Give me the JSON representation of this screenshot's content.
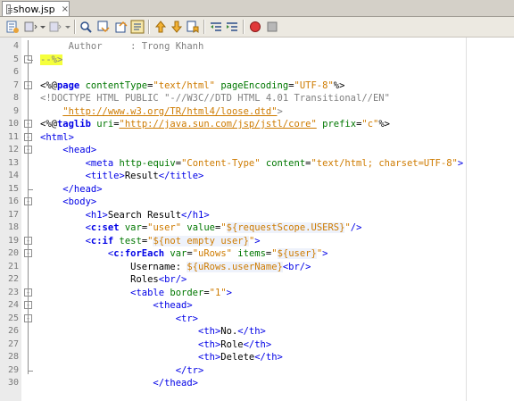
{
  "tab": {
    "title": "show.jsp",
    "close": "×"
  },
  "toolbar": {
    "buttons": [
      "go-to-source-icon",
      "back-icon",
      "forward-icon",
      "find-icon",
      "find-previous-icon",
      "find-next-icon",
      "toggle-highlight-icon",
      "previous-bookmark-icon",
      "next-bookmark-icon",
      "toggle-bookmark-icon",
      "shift-left-icon",
      "shift-right-icon",
      "start-macro-icon",
      "stop-macro-icon"
    ]
  },
  "editor": {
    "lines": [
      {
        "n": "4",
        "segs": [
          [
            "com",
            "     Author     : Trong Khanh"
          ]
        ]
      },
      {
        "n": "5",
        "segs": [
          [
            "yl",
            "--%>"
          ]
        ]
      },
      {
        "n": "6",
        "segs": []
      },
      {
        "n": "7",
        "segs": [
          [
            "dir",
            "<%@"
          ],
          [
            "kw",
            "page"
          ],
          [
            "attr",
            " contentType"
          ],
          [
            "dir",
            "="
          ],
          [
            "val",
            "\"text/html\""
          ],
          [
            "attr",
            " pageEncoding"
          ],
          [
            "dir",
            "="
          ],
          [
            "val",
            "\"UTF-8\""
          ],
          [
            "dir",
            "%>"
          ]
        ]
      },
      {
        "n": "8",
        "segs": [
          [
            "com",
            "<!DOCTYPE HTML PUBLIC \"-//W3C//DTD HTML 4.01 Transitional//EN\""
          ]
        ]
      },
      {
        "n": "9",
        "segs": [
          [
            "com",
            "    "
          ],
          [
            "url",
            "\"http://www.w3.org/TR/html4/loose.dtd\""
          ],
          [
            "com",
            ">"
          ]
        ]
      },
      {
        "n": "10",
        "segs": [
          [
            "dir",
            "<%@"
          ],
          [
            "kw",
            "taglib"
          ],
          [
            "attr",
            " uri"
          ],
          [
            "dir",
            "="
          ],
          [
            "url",
            "\"http://java.sun.com/jsp/jstl/core\""
          ],
          [
            "attr",
            " prefix"
          ],
          [
            "dir",
            "="
          ],
          [
            "val",
            "\"c\""
          ],
          [
            "dir",
            "%>"
          ]
        ]
      },
      {
        "n": "11",
        "segs": [
          [
            "tag",
            "<html>"
          ]
        ]
      },
      {
        "n": "12",
        "segs": [
          [
            "tag",
            "    <head>"
          ]
        ]
      },
      {
        "n": "13",
        "segs": [
          [
            "tag",
            "        <meta"
          ],
          [
            "attr",
            " http-equiv"
          ],
          [
            "dir",
            "="
          ],
          [
            "val",
            "\"Content-Type\""
          ],
          [
            "attr",
            " content"
          ],
          [
            "dir",
            "="
          ],
          [
            "val",
            "\"text/html; charset=UTF-8\""
          ],
          [
            "tag",
            ">"
          ]
        ]
      },
      {
        "n": "14",
        "segs": [
          [
            "tag",
            "        <title>"
          ],
          [
            "dir",
            "Result"
          ],
          [
            "tag",
            "</title>"
          ]
        ]
      },
      {
        "n": "15",
        "segs": [
          [
            "tag",
            "    </head>"
          ]
        ]
      },
      {
        "n": "16",
        "segs": [
          [
            "tag",
            "    <body>"
          ]
        ]
      },
      {
        "n": "17",
        "segs": [
          [
            "tag",
            "        <h1>"
          ],
          [
            "dir",
            "Search Result"
          ],
          [
            "tag",
            "</h1>"
          ]
        ]
      },
      {
        "n": "18",
        "segs": [
          [
            "tag",
            "        <"
          ],
          [
            "kw",
            "c:set"
          ],
          [
            "attr",
            " var"
          ],
          [
            "dir",
            "="
          ],
          [
            "val",
            "\"user\""
          ],
          [
            "attr",
            " value"
          ],
          [
            "dir",
            "="
          ],
          [
            "val",
            "\""
          ],
          [
            "el",
            "${requestScope.USERS}"
          ],
          [
            "val",
            "\""
          ],
          [
            "tag",
            "/>"
          ]
        ]
      },
      {
        "n": "19",
        "segs": [
          [
            "tag",
            "        <"
          ],
          [
            "kw",
            "c:if"
          ],
          [
            "attr",
            " test"
          ],
          [
            "dir",
            "="
          ],
          [
            "val",
            "\""
          ],
          [
            "el",
            "${not empty user}"
          ],
          [
            "val",
            "\""
          ],
          [
            "tag",
            ">"
          ]
        ]
      },
      {
        "n": "20",
        "segs": [
          [
            "tag",
            "            <"
          ],
          [
            "kw",
            "c:forEach"
          ],
          [
            "attr",
            " var"
          ],
          [
            "dir",
            "="
          ],
          [
            "val",
            "\"uRows\""
          ],
          [
            "attr",
            " items"
          ],
          [
            "dir",
            "="
          ],
          [
            "val",
            "\""
          ],
          [
            "el",
            "${user}"
          ],
          [
            "val",
            "\""
          ],
          [
            "tag",
            ">"
          ]
        ]
      },
      {
        "n": "21",
        "segs": [
          [
            "dir",
            "                Username: "
          ],
          [
            "el",
            "${uRows.userName}"
          ],
          [
            "tag",
            "<br/>"
          ]
        ]
      },
      {
        "n": "22",
        "segs": [
          [
            "dir",
            "                Roles"
          ],
          [
            "tag",
            "<br/>"
          ]
        ]
      },
      {
        "n": "23",
        "segs": [
          [
            "tag",
            "                <table"
          ],
          [
            "attr",
            " border"
          ],
          [
            "dir",
            "="
          ],
          [
            "val",
            "\"1\""
          ],
          [
            "tag",
            ">"
          ]
        ]
      },
      {
        "n": "24",
        "segs": [
          [
            "tag",
            "                    <thead>"
          ]
        ]
      },
      {
        "n": "25",
        "segs": [
          [
            "tag",
            "                        <tr>"
          ]
        ]
      },
      {
        "n": "26",
        "segs": [
          [
            "tag",
            "                            <th>"
          ],
          [
            "dir",
            "No."
          ],
          [
            "tag",
            "</th>"
          ]
        ]
      },
      {
        "n": "27",
        "segs": [
          [
            "tag",
            "                            <th>"
          ],
          [
            "dir",
            "Role"
          ],
          [
            "tag",
            "</th>"
          ]
        ]
      },
      {
        "n": "28",
        "segs": [
          [
            "tag",
            "                            <th>"
          ],
          [
            "dir",
            "Delete"
          ],
          [
            "tag",
            "</th>"
          ]
        ]
      },
      {
        "n": "29",
        "segs": [
          [
            "tag",
            "                        </tr>"
          ]
        ]
      },
      {
        "n": "30",
        "segs": [
          [
            "tag",
            "                    </thead>"
          ]
        ]
      }
    ]
  }
}
